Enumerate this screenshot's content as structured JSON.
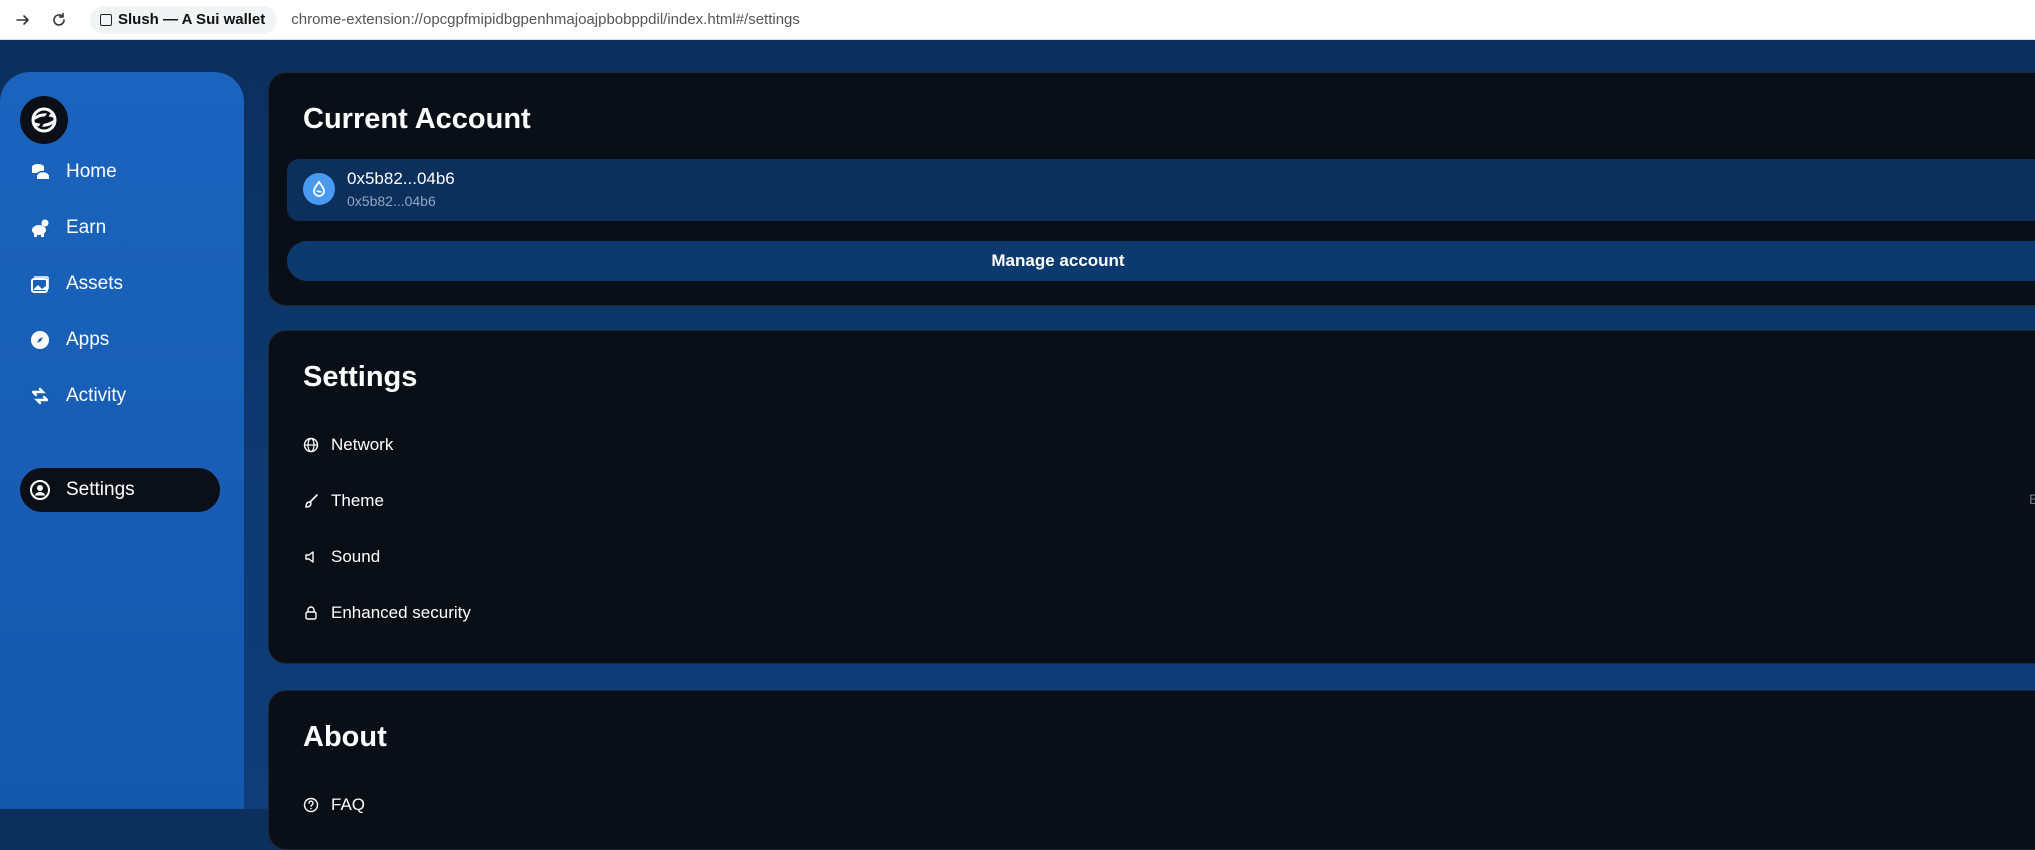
{
  "browser": {
    "tab_title": "Slush — A Sui wallet",
    "url": "chrome-extension://opcgpfmipidbgpenhmajoajpbobppdil/index.html#/settings"
  },
  "sidebar": {
    "items": [
      {
        "label": "Home",
        "icon": "home-icon"
      },
      {
        "label": "Earn",
        "icon": "piggy-bank-icon"
      },
      {
        "label": "Assets",
        "icon": "image-gallery-icon"
      },
      {
        "label": "Apps",
        "icon": "compass-icon"
      },
      {
        "label": "Activity",
        "icon": "swap-arrows-icon"
      },
      {
        "label": "Settings",
        "icon": "user-circle-icon",
        "active": true
      }
    ]
  },
  "current_account": {
    "title": "Current Account",
    "name": "0x5b82...04b6",
    "address": "0x5b82...04b6",
    "manage_label": "Manage account"
  },
  "settings": {
    "title": "Settings",
    "items": [
      {
        "label": "Network",
        "icon": "globe-icon"
      },
      {
        "label": "Theme",
        "icon": "brush-icon"
      },
      {
        "label": "Sound",
        "icon": "speaker-icon"
      },
      {
        "label": "Enhanced security",
        "icon": "lock-icon"
      }
    ],
    "theme_value_partial": "E"
  },
  "about": {
    "title": "About",
    "items": [
      {
        "label": "FAQ",
        "icon": "question-icon"
      }
    ]
  },
  "colors": {
    "sidebar": "#1a5fb4",
    "card": "#0a0f17",
    "accent_row": "#0d2f5c",
    "avatar": "#4a9bf0"
  }
}
